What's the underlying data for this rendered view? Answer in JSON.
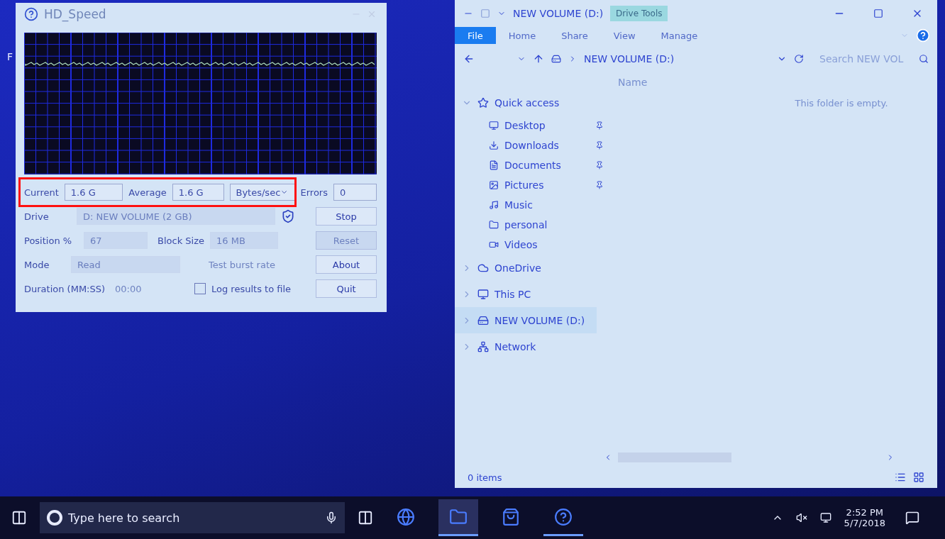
{
  "desktop": {
    "edge_text": "F"
  },
  "hd_speed": {
    "title": "HD_Speed",
    "current": {
      "label": "Current",
      "value": "1.6 G"
    },
    "average": {
      "label": "Average",
      "value": "1.6 G"
    },
    "unit": {
      "value": "Bytes/sec"
    },
    "errors": {
      "label": "Errors",
      "value": "0"
    },
    "drive": {
      "label": "Drive",
      "value": "D: NEW VOLUME (2 GB)",
      "disabled": true
    },
    "position": {
      "label": "Position %",
      "value": "67",
      "disabled": true
    },
    "block_size": {
      "label": "Block Size",
      "value": "16 MB",
      "disabled": true
    },
    "mode": {
      "label": "Mode",
      "value": "Read",
      "disabled": true
    },
    "test_burst": {
      "label": "Test burst rate",
      "disabled": true
    },
    "duration": {
      "label": "Duration (MM:SS)",
      "value": "00:00",
      "disabled": true
    },
    "log": {
      "label": "Log results to file",
      "checked": false
    },
    "buttons": [
      {
        "label": "Stop",
        "disabled": false
      },
      {
        "label": "Reset",
        "disabled": true
      },
      {
        "label": "About",
        "disabled": false
      },
      {
        "label": "Quit",
        "disabled": false
      }
    ]
  },
  "explorer": {
    "title": "NEW VOLUME (D:)",
    "context_tab": "Drive Tools",
    "ribbon_tabs": [
      {
        "label": "File",
        "selected": true
      },
      {
        "label": "Home",
        "selected": false
      },
      {
        "label": "Share",
        "selected": false
      },
      {
        "label": "View",
        "selected": false
      },
      {
        "label": "Manage",
        "selected": false
      }
    ],
    "address": "NEW VOLUME (D:)",
    "search": {
      "placeholder": "Search NEW VOL"
    },
    "column": "Name",
    "nav": [
      {
        "label": "Quick access",
        "kind": "star",
        "expanded": true,
        "selected": false,
        "children": [
          {
            "label": "Desktop",
            "kind": "desktop",
            "pinned": true
          },
          {
            "label": "Downloads",
            "kind": "download",
            "pinned": true
          },
          {
            "label": "Documents",
            "kind": "document",
            "pinned": true
          },
          {
            "label": "Pictures",
            "kind": "picture",
            "pinned": true
          },
          {
            "label": "Music",
            "kind": "music",
            "pinned": false
          },
          {
            "label": "personal",
            "kind": "folder",
            "pinned": false
          },
          {
            "label": "Videos",
            "kind": "video",
            "pinned": false
          }
        ]
      },
      {
        "label": "OneDrive",
        "kind": "cloud",
        "expanded": false,
        "selected": false
      },
      {
        "label": "This PC",
        "kind": "pc",
        "expanded": false,
        "selected": false
      },
      {
        "label": "NEW VOLUME (D:)",
        "kind": "drive",
        "expanded": false,
        "selected": true
      },
      {
        "label": "Network",
        "kind": "network",
        "expanded": false,
        "selected": false
      }
    ],
    "empty_message": "This folder is empty.",
    "status": "0 items"
  },
  "taskbar": {
    "search": {
      "placeholder": "Type here to search"
    },
    "apps": [
      {
        "kind": "edge",
        "running": false,
        "active": false
      },
      {
        "kind": "explorer",
        "running": true,
        "active": true
      },
      {
        "kind": "store",
        "running": false,
        "active": false
      },
      {
        "kind": "help",
        "running": true,
        "active": false
      }
    ],
    "time": "2:52 PM",
    "date": "5/7/2018"
  }
}
